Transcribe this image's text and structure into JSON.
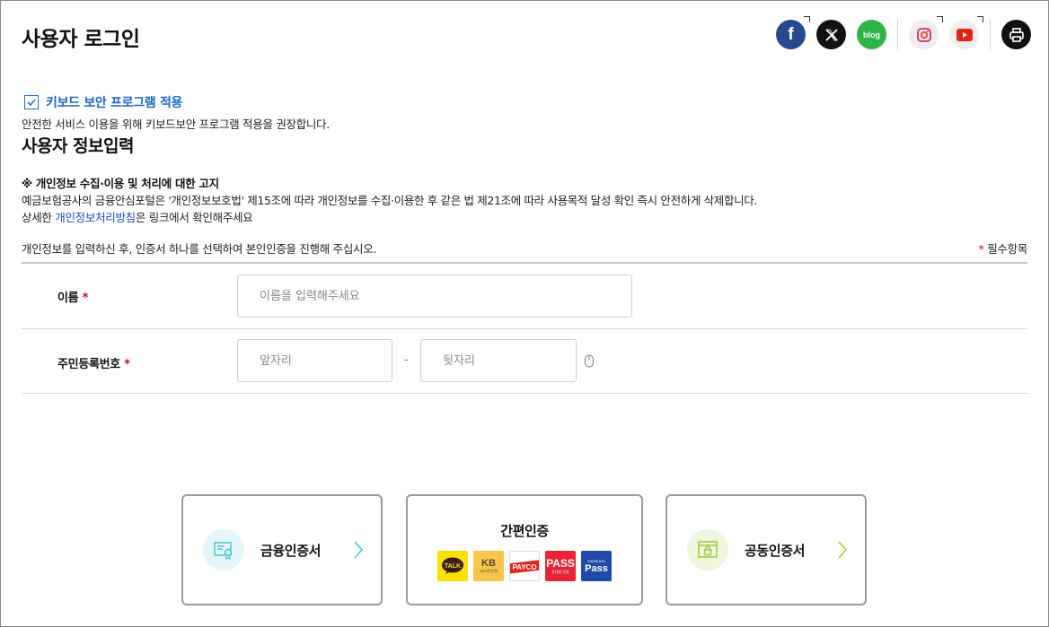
{
  "header": {
    "title": "사용자 로그인",
    "social": {
      "facebook_label": "f",
      "blog_label": "blog"
    }
  },
  "keyboard_security": {
    "label": "키보드 보안 프로그램 적용",
    "description": "안전한 서비스 이용을 위해 키보드보안 프로그램 적용을 권장합니다.",
    "checked": true
  },
  "section": {
    "title": "사용자 정보입력"
  },
  "notice": {
    "title": "※ 개인정보 수집·이용 및 처리에 대한 고지",
    "body": "예금보험공사의 금융안심포털은 '개인정보보호법' 제15조에 따라 개인정보를 수집·이용한 후 같은 법 제21조에 따라 사용목적 달성 확인 즉시 안전하게 삭제합니다.",
    "detail_prefix": "상세한 ",
    "link_text": "개인정보처리방침",
    "detail_suffix": "은 링크에서 확인해주세요"
  },
  "guide": {
    "text": "개인정보를 입력하신 후, 인증서 하나를 선택하여 본인인증을 진행해 주십시오.",
    "required_mark": "*",
    "required_text": " 필수항목"
  },
  "form": {
    "name": {
      "label": "이름",
      "required_mark": "*",
      "placeholder": "이름을 입력해주세요"
    },
    "rrn": {
      "label": "주민등록번호",
      "required_mark": "*",
      "front_placeholder": "앞자리",
      "separator": "-",
      "back_placeholder": "뒷자리"
    }
  },
  "auth": {
    "financial": {
      "label": "금융인증서",
      "accent": "#43c3d3"
    },
    "simple": {
      "title": "간편인증",
      "badges": [
        "TALK",
        "KB",
        "PAYCO",
        "PASS",
        "Pass"
      ],
      "kb_sub": "KB국민은행",
      "pass_sub": "휴대폰 인증",
      "samsung_sub": "SAMSUNG"
    },
    "joint": {
      "label": "공동인증서",
      "accent": "#9ccc3a"
    }
  },
  "colors": {
    "accent_blue": "#1a67c4",
    "required_red": "#d0021b",
    "kakao_yellow": "#fae100",
    "pass_red": "#ea2336",
    "samsung_blue": "#1f4aa8"
  }
}
